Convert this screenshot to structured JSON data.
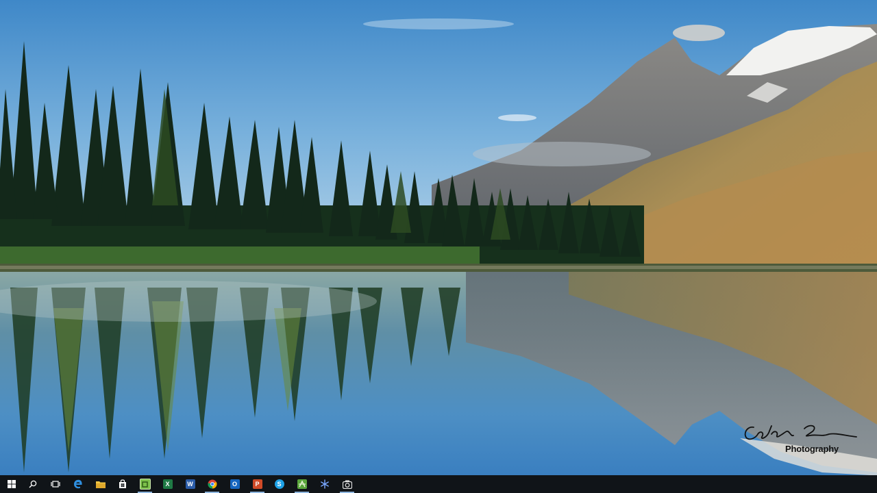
{
  "desktop": {
    "wallpaper": "mountain-lake-reflection",
    "watermark": {
      "signature": "Colby Brown",
      "label": "Photography"
    }
  },
  "taskbar": {
    "background": "#101418",
    "items": [
      {
        "name": "start-button",
        "icon": "windows-logo-icon"
      },
      {
        "name": "search-button",
        "icon": "search-icon"
      },
      {
        "name": "task-view-button",
        "icon": "task-view-icon"
      },
      {
        "name": "edge-button",
        "icon": "edge-icon",
        "color": "#2f8fe0"
      },
      {
        "name": "file-explorer-button",
        "icon": "folder-icon",
        "color": "#f2c744"
      },
      {
        "name": "store-button",
        "icon": "store-icon",
        "color": "#ffffff"
      },
      {
        "name": "camtasia-button",
        "icon": "camtasia-icon",
        "color": "#7cc04a"
      },
      {
        "name": "excel-button",
        "icon": "excel-icon",
        "color": "#1f7a45"
      },
      {
        "name": "word-button",
        "icon": "word-icon",
        "color": "#2b5ca8"
      },
      {
        "name": "chrome-button",
        "icon": "chrome-icon"
      },
      {
        "name": "outlook-button",
        "icon": "outlook-icon",
        "color": "#1565c0"
      },
      {
        "name": "powerpoint-button",
        "icon": "powerpoint-icon",
        "color": "#d04a27"
      },
      {
        "name": "skype-button",
        "icon": "skype-icon",
        "color": "#1ea1e6"
      },
      {
        "name": "greenshot-button",
        "icon": "greenshot-icon",
        "color": "#5aa63c"
      },
      {
        "name": "snowflake-app-button",
        "icon": "snowflake-icon",
        "color": "#5a8ff0"
      },
      {
        "name": "camera-app-button",
        "icon": "camera-icon",
        "color": "#e6e6e6"
      }
    ]
  }
}
